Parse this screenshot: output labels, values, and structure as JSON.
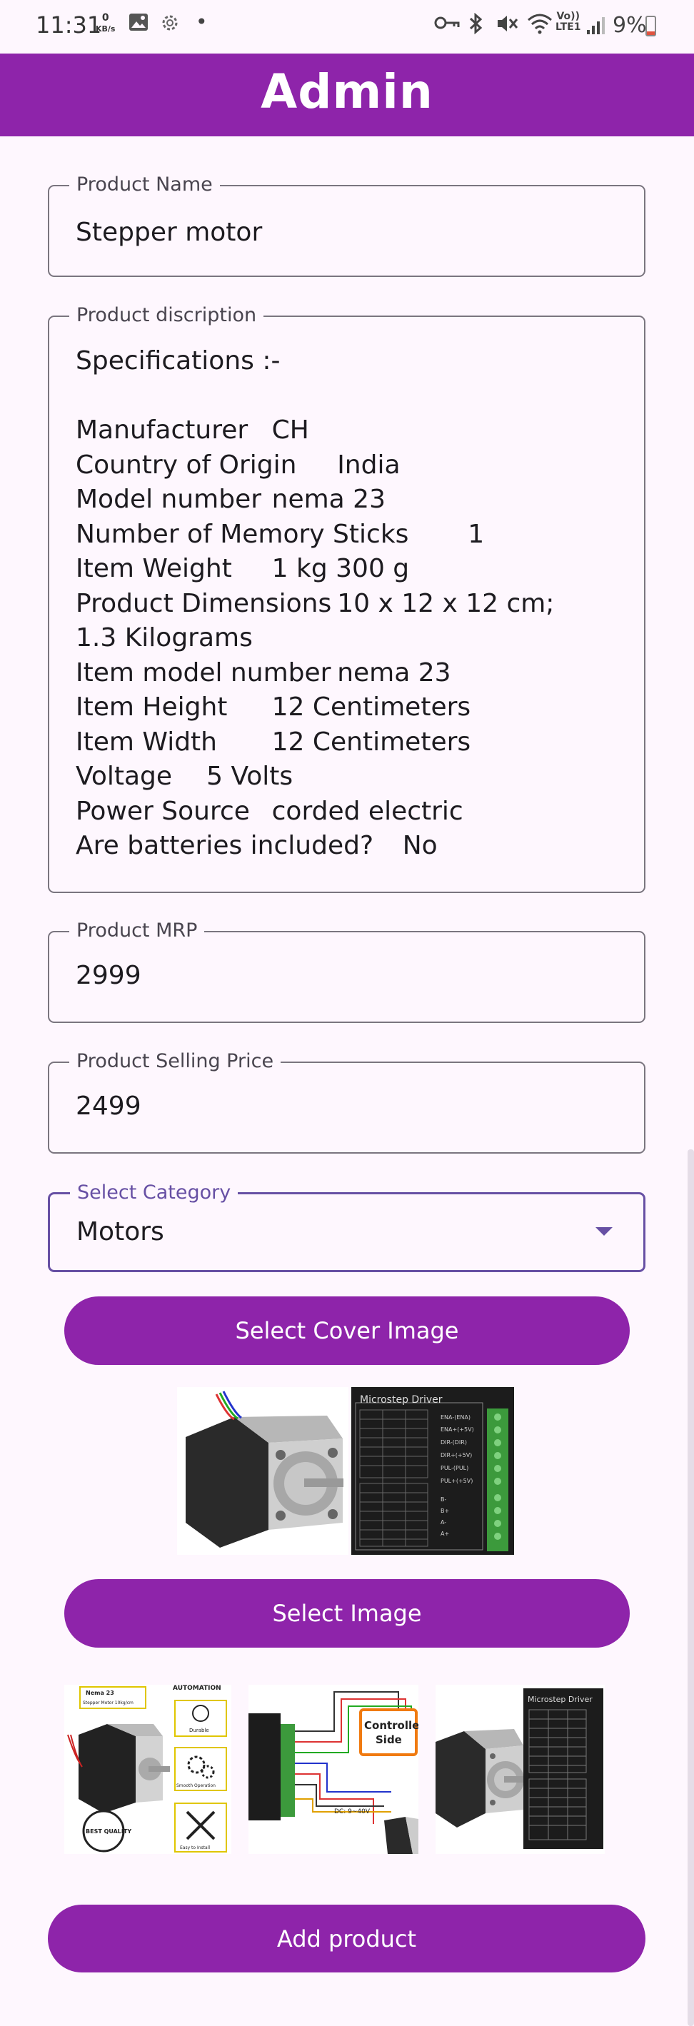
{
  "status_bar": {
    "time": "11:31",
    "speed_value": "0",
    "speed_unit": "KB/s",
    "battery": "9%",
    "icons": [
      "gallery-icon",
      "settings-icon",
      "dot-icon",
      "key-icon",
      "bluetooth-icon",
      "mute-icon",
      "wifi-icon",
      "volte-icon",
      "signal-icon",
      "battery-icon"
    ]
  },
  "app_bar": {
    "title": "Admin"
  },
  "form": {
    "product_name": {
      "label": "Product Name",
      "value": "Stepper motor"
    },
    "product_description": {
      "label": "Product discription",
      "lines": [
        "Specifications :-",
        "",
        "Manufacturer\tCH",
        "Country of Origin\tIndia",
        "Model number\tnema 23",
        "Number of Memory Sticks\t1",
        "Item Weight\t1 kg 300 g",
        "Product Dimensions\t10 x 12 x 12 cm;",
        "1.3 Kilograms",
        "Item model number\tnema 23",
        "Item Height\t12 Centimeters",
        "Item Width\t12 Centimeters",
        "Voltage\t5 Volts",
        "Power Source\tcorded electric",
        "Are batteries included?\tNo"
      ]
    },
    "product_mrp": {
      "label": "Product MRP",
      "value": "2999"
    },
    "product_selling_price": {
      "label": "Product Selling Price",
      "value": "2499"
    },
    "category": {
      "label": "Select Category",
      "value": "Motors"
    }
  },
  "buttons": {
    "select_cover_image": "Select Cover Image",
    "select_image": "Select Image",
    "add_product": "Add product"
  },
  "cover_images": [
    {
      "name": "stepper-motor-photo"
    },
    {
      "name": "microstep-driver-photo",
      "title_text": "Microstep Driver"
    }
  ],
  "product_images": [
    {
      "name": "nema23-features-image",
      "text": [
        "Nema 23",
        "Stepper Motor 10kg/cm",
        "AUTOMATION",
        "Durable",
        "Smooth Operation",
        "BEST QUALITY",
        "Easy to Install"
      ]
    },
    {
      "name": "wiring-diagram-image",
      "text": [
        "Controller",
        "Side",
        "DC: 9~40V"
      ]
    },
    {
      "name": "stepper-motor-photo"
    },
    {
      "name": "microstep-driver-photo",
      "title_text": "Microstep Driver"
    }
  ],
  "colors": {
    "primary": "#8e24aa",
    "background": "#fef7fe",
    "outline": "#7a757f",
    "focused_outline": "#6750a4"
  }
}
